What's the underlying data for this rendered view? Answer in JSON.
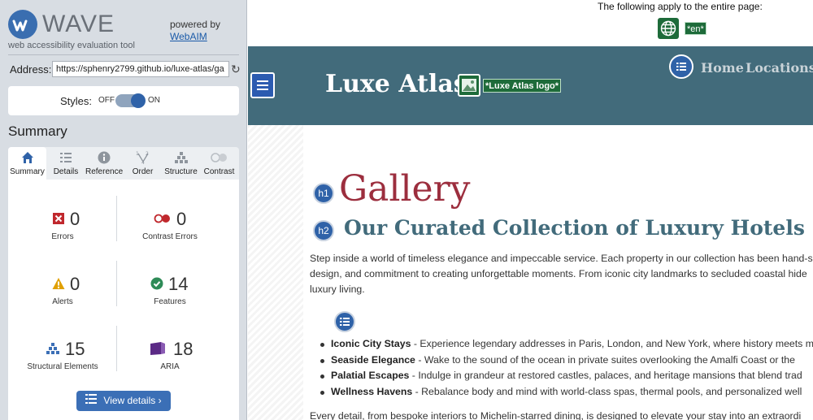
{
  "sidebar": {
    "brand_name": "WAVE",
    "brand_tagline": "web accessibility evaluation tool",
    "powered_by": "powered by",
    "powered_link": "WebAIM",
    "address_label": "Address:",
    "address_value": "https://sphenry2799.github.io/luxe-atlas/ga",
    "styles_label": "Styles:",
    "styles_off": "OFF",
    "styles_on": "ON",
    "styles_enabled": true,
    "summary_title": "Summary",
    "tabs": [
      {
        "label": "Summary",
        "icon": "home-icon",
        "active": true
      },
      {
        "label": "Details",
        "icon": "list-icon",
        "active": false
      },
      {
        "label": "Reference",
        "icon": "info-icon",
        "active": false
      },
      {
        "label": "Order",
        "icon": "order-icon",
        "active": false
      },
      {
        "label": "Structure",
        "icon": "structure-icon",
        "active": false
      },
      {
        "label": "Contrast",
        "icon": "contrast-icon",
        "active": false
      }
    ],
    "stats": {
      "errors": {
        "count": "0",
        "label": "Errors",
        "icon": "error-icon",
        "color": "#c0282d"
      },
      "contrast_errors": {
        "count": "0",
        "label": "Contrast Errors",
        "icon": "contrast-error-icon",
        "color": "#c0282d"
      },
      "alerts": {
        "count": "0",
        "label": "Alerts",
        "icon": "alert-icon",
        "color": "#e0a000"
      },
      "features": {
        "count": "14",
        "label": "Features",
        "icon": "feature-icon",
        "color": "#2e8b57"
      },
      "structural": {
        "count": "15",
        "label": "Structural Elements",
        "icon": "structure-icon",
        "color": "#3b6fb6"
      },
      "aria": {
        "count": "18",
        "label": "ARIA",
        "icon": "aria-icon",
        "color": "#5b2a86"
      }
    },
    "view_details": "View details ›"
  },
  "page": {
    "applies_text": "The following apply to the entire page:",
    "lang_tag": "*en*",
    "site_title": "Luxe Atlas",
    "logo_alt": "*Luxe Atlas logo*",
    "nav": [
      "Home",
      "Locations"
    ],
    "h1_badge": "h1",
    "h1": "Gallery",
    "h2_badge": "h2",
    "h2": "Our Curated Collection of Luxury Hotels",
    "intro_lines": [
      "Step inside a world of timeless elegance and impeccable service. Each property in our collection has been hand-s",
      "design, and commitment to creating unforgettable moments. From iconic city landmarks to secluded coastal hide",
      "luxury living."
    ],
    "bullets": [
      {
        "title": "Iconic City Stays",
        "text": " - Experience legendary addresses in Paris, London, and New York, where history meets m"
      },
      {
        "title": "Seaside Elegance",
        "text": " - Wake to the sound of the ocean in private suites overlooking the Amalfi Coast or the"
      },
      {
        "title": "Palatial Escapes",
        "text": " - Indulge in grandeur at restored castles, palaces, and heritage mansions that blend trad"
      },
      {
        "title": "Wellness Havens",
        "text": " - Rebalance body and mind with world-class spas, thermal pools, and personalized well"
      }
    ],
    "outro": "Every detail, from bespoke interiors to Michelin-starred dining, is designed to elevate your stay into an extraordi"
  }
}
